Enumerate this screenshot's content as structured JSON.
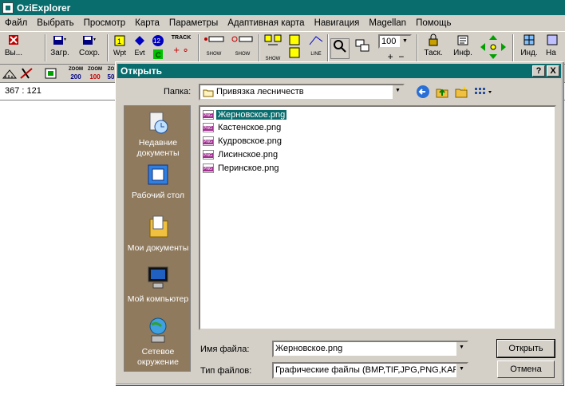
{
  "app": {
    "title": "OziExplorer"
  },
  "menu": [
    "Файл",
    "Выбрать",
    "Просмотр",
    "Карта",
    "Параметры",
    "Адаптивная карта",
    "Навигация",
    "Magellan",
    "Помощь"
  ],
  "toolbar": {
    "exit": "Вы...",
    "load": "Загр.",
    "save": "Сохр.",
    "wpt": "Wpt",
    "evt": "Evt",
    "track": "TRACK",
    "show1": "SHOW",
    "show2": "SHOW",
    "show3": "SHOW",
    "line": "LINE",
    "zoom_value": "100",
    "task": "Таск.",
    "info": "Инф.",
    "ind": "Инд.",
    "more": "На"
  },
  "toolbar2": {
    "zoom1_label": "ZOOM",
    "zoom1_value": "200",
    "zoom2_label": "ZOOM",
    "zoom2_value": "100",
    "zoom3_label": "ZO",
    "zoom3_value": "50"
  },
  "status": {
    "coords": "367 : 121"
  },
  "dialog": {
    "title": "Открыть",
    "help_btn": "?",
    "close_btn": "X",
    "folder_label": "Папка:",
    "folder_value": "Привязка лесничеств",
    "places": [
      "Недавние документы",
      "Рабочий стол",
      "Мои документы",
      "Мой компьютер",
      "Сетевое окружение"
    ],
    "files": [
      "Жерновское.png",
      "Кастенское.png",
      "Кудровское.png",
      "Лисинское.png",
      "Перинское.png"
    ],
    "filename_label": "Имя файла:",
    "filename_value": "Жерновское.png",
    "filetype_label": "Тип файлов:",
    "filetype_value": "Графические файлы (BMP,TIF,JPG,PNG,KAP",
    "open_btn": "Открыть",
    "cancel_btn": "Отмена"
  },
  "colors": {
    "titlebar": "#0a6d6d",
    "places_bg": "#8f7a5e",
    "chrome": "#d4d0c8"
  }
}
